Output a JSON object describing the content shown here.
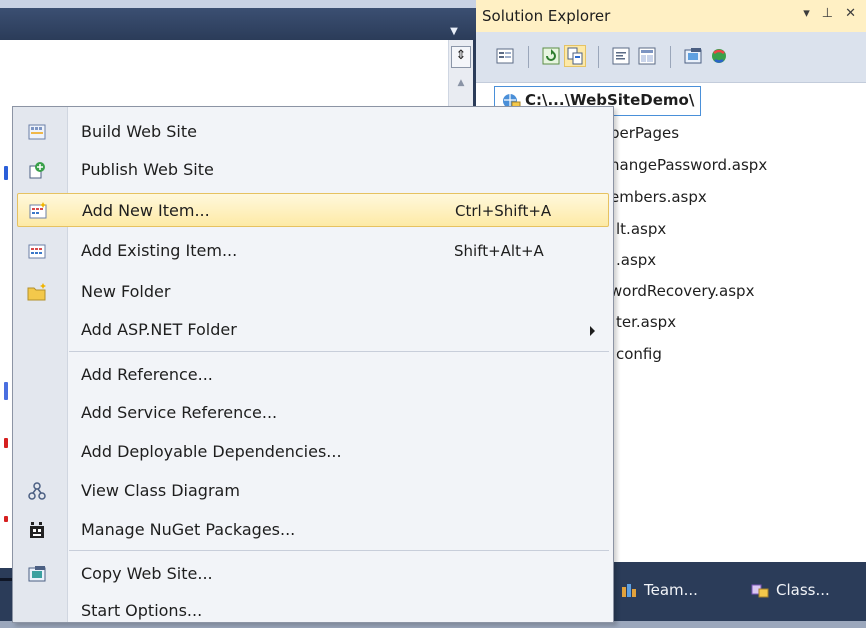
{
  "editor": {
    "dropdown_glyph": "▼",
    "split_glyph": "⇕",
    "scroll_up_glyph": "▲"
  },
  "solution_explorer": {
    "title": "Solution Explorer",
    "controls": [
      "▾",
      "⊥",
      "✕"
    ],
    "root": "C:\\...\\WebSiteDemo\\",
    "items": [
      "berPages",
      "hangePassword.aspx",
      "embers.aspx",
      "lt.aspx",
      ".aspx",
      "wordRecovery.aspx",
      "ter.aspx",
      "config"
    ],
    "bottom_tabs": [
      {
        "label": "Team...",
        "icon": "team-explorer-icon"
      },
      {
        "label": "Class...",
        "icon": "class-view-icon"
      }
    ]
  },
  "menu": {
    "items": [
      {
        "label": "Build Web Site",
        "icon": "build-icon",
        "shortcut": ""
      },
      {
        "label": "Publish Web Site",
        "icon": "publish-icon",
        "shortcut": ""
      },
      {
        "label": "Add New Item...",
        "icon": "add-new-item-icon",
        "shortcut": "Ctrl+Shift+A",
        "highlighted": true
      },
      {
        "label": "Add Existing Item...",
        "icon": "add-existing-item-icon",
        "shortcut": "Shift+Alt+A"
      },
      {
        "label": "New Folder",
        "icon": "new-folder-icon",
        "shortcut": ""
      },
      {
        "label": "Add ASP.NET Folder",
        "icon": "",
        "shortcut": "",
        "submenu": true
      },
      {
        "label": "Add Reference...",
        "icon": "",
        "shortcut": ""
      },
      {
        "label": "Add Service Reference...",
        "icon": "",
        "shortcut": ""
      },
      {
        "label": "Add Deployable Dependencies...",
        "icon": "",
        "shortcut": ""
      },
      {
        "label": "View Class Diagram",
        "icon": "class-diagram-icon",
        "shortcut": ""
      },
      {
        "label": "Manage NuGet Packages...",
        "icon": "nuget-icon",
        "shortcut": ""
      },
      {
        "label": "Copy Web Site...",
        "icon": "copy-web-site-icon",
        "shortcut": ""
      },
      {
        "label": "Start Options...",
        "icon": "",
        "shortcut": ""
      }
    ]
  },
  "colors": {
    "chrome_dark": "#2b3c59",
    "highlight": "#fdeaa6",
    "title_bar": "#fff0c4"
  }
}
